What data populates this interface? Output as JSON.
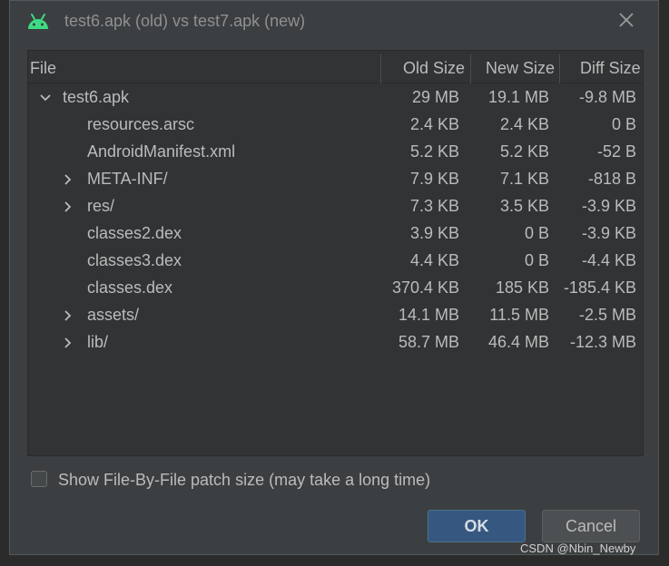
{
  "dialog": {
    "title": "test6.apk (old) vs test7.apk (new)"
  },
  "table": {
    "headers": {
      "file": "File",
      "old_size": "Old Size",
      "new_size": "New Size",
      "diff_size": "Diff Size"
    },
    "rows": [
      {
        "name": "test6.apk",
        "old": "29 MB",
        "new": "19.1 MB",
        "diff": "-9.8 MB",
        "expander": "expanded"
      },
      {
        "name": "resources.arsc",
        "old": "2.4 KB",
        "new": "2.4 KB",
        "diff": "0 B",
        "expander": "none"
      },
      {
        "name": "AndroidManifest.xml",
        "old": "5.2 KB",
        "new": "5.2 KB",
        "diff": "-52 B",
        "expander": "none"
      },
      {
        "name": "META-INF/",
        "old": "7.9 KB",
        "new": "7.1 KB",
        "diff": "-818 B",
        "expander": "collapsed"
      },
      {
        "name": "res/",
        "old": "7.3 KB",
        "new": "3.5 KB",
        "diff": "-3.9 KB",
        "expander": "collapsed"
      },
      {
        "name": "classes2.dex",
        "old": "3.9 KB",
        "new": "0 B",
        "diff": "-3.9 KB",
        "expander": "none"
      },
      {
        "name": "classes3.dex",
        "old": "4.4 KB",
        "new": "0 B",
        "diff": "-4.4 KB",
        "expander": "none"
      },
      {
        "name": "classes.dex",
        "old": "370.4 KB",
        "new": "185 KB",
        "diff": "-185.4 KB",
        "expander": "none"
      },
      {
        "name": "assets/",
        "old": "14.1 MB",
        "new": "11.5 MB",
        "diff": "-2.5 MB",
        "expander": "collapsed"
      },
      {
        "name": "lib/",
        "old": "58.7 MB",
        "new": "46.4 MB",
        "diff": "-12.3 MB",
        "expander": "collapsed"
      }
    ]
  },
  "options": {
    "checkbox_label": "Show File-By-File patch size (may take a long time)",
    "checked": false
  },
  "buttons": {
    "ok": "OK",
    "cancel": "Cancel"
  },
  "watermark": "CSDN @Nbin_Newby",
  "colors": {
    "accent": "#365880",
    "android_green": "#3ddc84",
    "background": "#3c3f41"
  }
}
